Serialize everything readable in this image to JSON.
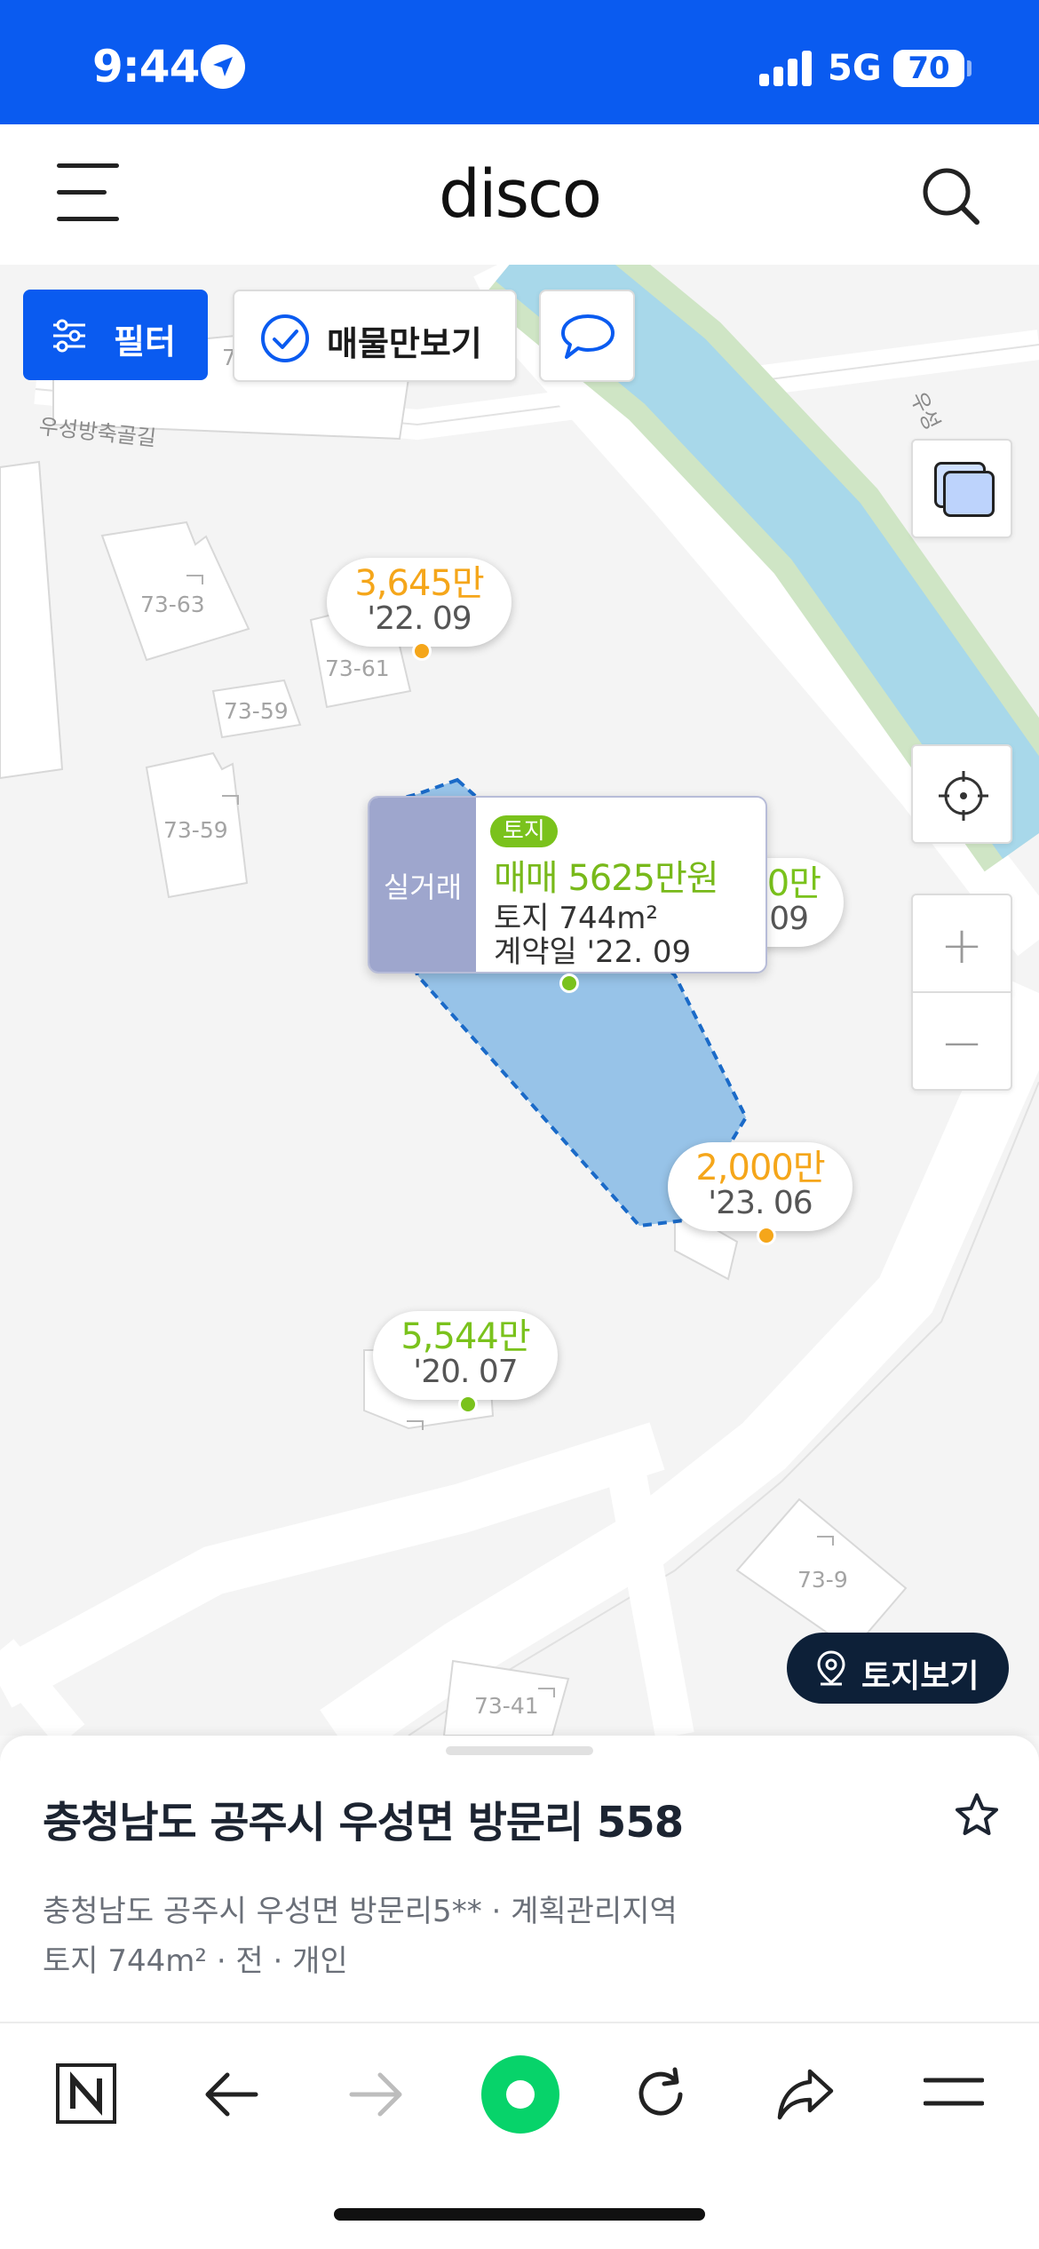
{
  "status": {
    "time": "9:44",
    "network": "5G",
    "battery": "70"
  },
  "appbar": {
    "brand": "disco"
  },
  "map": {
    "filter_label": "필터",
    "listing_only_label": "매물만보기",
    "street_labels": [
      "우성방축골길",
      "우성"
    ],
    "building_labels": [
      "73-63",
      "73-61",
      "73-59",
      "73-59",
      "73-9",
      "73-41",
      "7"
    ],
    "price_pins": [
      {
        "amount": "3,645만",
        "date": "'22. 09",
        "color": "#f5a61a"
      },
      {
        "amount": "0만",
        "date": "09",
        "color": "#7ac21c"
      },
      {
        "amount": "2,000만",
        "date": "'23. 06",
        "color": "#f5a61a"
      },
      {
        "amount": "5,544만",
        "date": "'20. 07",
        "color": "#7ac21c"
      }
    ],
    "deal_card": {
      "side_label": "실거래",
      "tag": "토지",
      "title": "매매 5625만원",
      "line1": "토지 744m²",
      "line2": "계약일 '22. 09"
    },
    "land_view_label": "토지보기"
  },
  "sheet": {
    "address": "충청남도 공주시 우성면 방문리 558",
    "meta_line1": "충청남도 공주시 우성면 방문리5** · 계획관리지역",
    "meta_line2": "토지 744m² · 전 · 개인"
  },
  "toolbar": {
    "icons": [
      "naver-icon",
      "back-arrow-icon",
      "forward-arrow-icon",
      "green-dot-icon",
      "refresh-icon",
      "share-icon",
      "menu-icon"
    ]
  },
  "colors": {
    "brand_blue": "#0a5bf0",
    "river": "#a8d8ea",
    "parcel": "#97c3e8",
    "green_price": "#7ac21c",
    "orange_price": "#f5a61a"
  }
}
